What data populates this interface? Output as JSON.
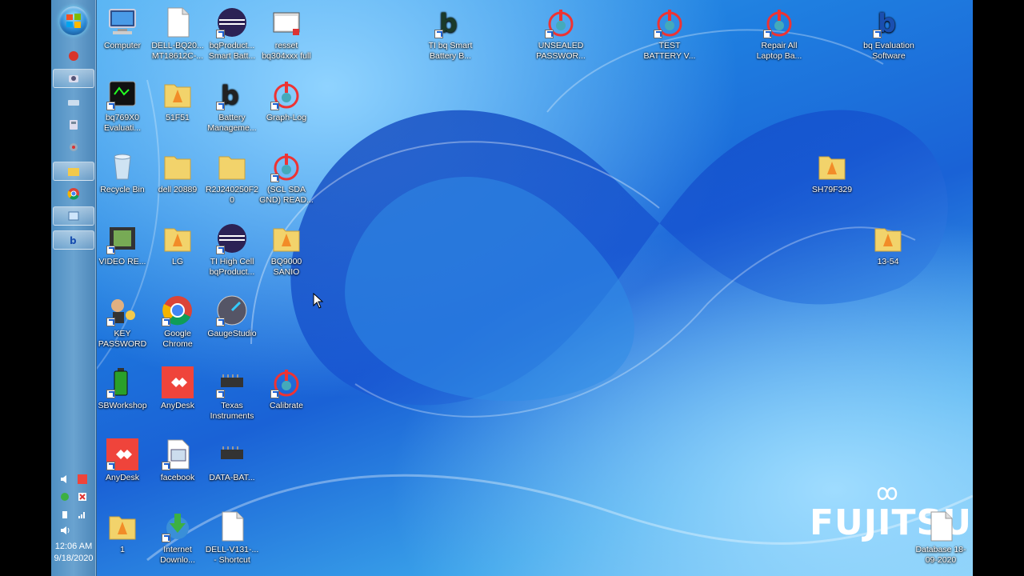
{
  "taskbar": {
    "clock_time": "12:06 AM",
    "clock_date": "9/18/2020"
  },
  "desktop_icons": [
    {
      "label": "Computer"
    },
    {
      "label": "DELL-BQ20... MT18612C-..."
    },
    {
      "label": "bqProduct... Smart Batt..."
    },
    {
      "label": "resset bq304xxx full"
    },
    {
      "label": "TI bq Smart Battery B..."
    },
    {
      "label": "UNSEALED PASSWOR..."
    },
    {
      "label": "TEST BATTERY V..."
    },
    {
      "label": "Repair All Laptop Ba..."
    },
    {
      "label": "bq Evaluation Software"
    },
    {
      "label": "bq769X0 Evaluati..."
    },
    {
      "label": "51F51"
    },
    {
      "label": "Battery Manageme..."
    },
    {
      "label": "Graph-Log"
    },
    {
      "label": "Recycle Bin"
    },
    {
      "label": "dell 20889"
    },
    {
      "label": "R2J240250F20"
    },
    {
      "label": "(SCL SDA GND) READ..."
    },
    {
      "label": "SH79F329"
    },
    {
      "label": "VIDEO RE..."
    },
    {
      "label": "LG"
    },
    {
      "label": "TI High Cell bqProduct..."
    },
    {
      "label": "BQ9000 SANIO"
    },
    {
      "label": "13-54"
    },
    {
      "label": "KEY PASSWORD"
    },
    {
      "label": "Google Chrome"
    },
    {
      "label": "GaugeStudio"
    },
    {
      "label": "SBWorkshop"
    },
    {
      "label": "AnyDesk"
    },
    {
      "label": "Texas Instruments"
    },
    {
      "label": "Calibrate"
    },
    {
      "label": "AnyDesk"
    },
    {
      "label": "facebook"
    },
    {
      "label": "DATA-BAT..."
    },
    {
      "label": "1"
    },
    {
      "label": "Internet Downlo..."
    },
    {
      "label": "DELL-V131-... - Shortcut"
    },
    {
      "label": "Database 18-09-2020"
    }
  ],
  "wallpaper": {
    "brand": "FUJITSU"
  },
  "colors": {
    "desktop_blue": "#1f7fe0",
    "taskbar": "#5b96c8",
    "anydesk_red": "#ef443b",
    "folder_yellow": "#f2d36b"
  }
}
